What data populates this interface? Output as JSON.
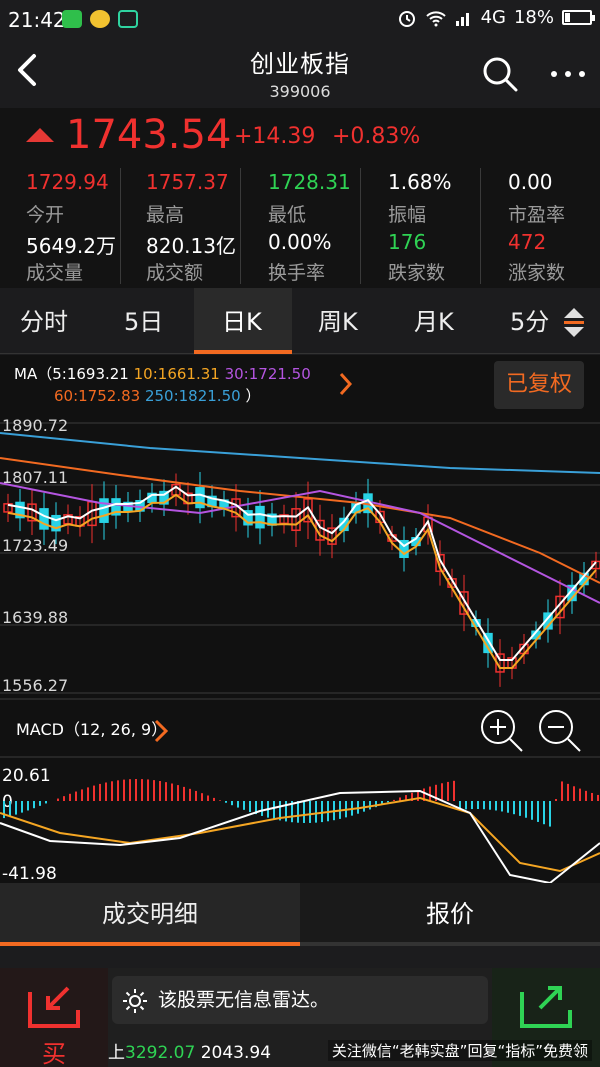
{
  "status_bar": {
    "time": "21:42",
    "network": "4G",
    "battery": "18%"
  },
  "header": {
    "title": "创业板指",
    "code": "399006"
  },
  "quote": {
    "price": "1743.54",
    "change": "+14.39",
    "change_pct": "+0.83%",
    "stats": [
      {
        "value": "1729.94",
        "label": "今开",
        "color": "red"
      },
      {
        "value": "1757.37",
        "label": "最高",
        "color": "red"
      },
      {
        "value": "1728.31",
        "label": "最低",
        "color": "green"
      },
      {
        "value": "1.68%",
        "label": "振幅",
        "color": "white"
      },
      {
        "value": "0.00",
        "label": "市盈率",
        "color": "white"
      },
      {
        "value": "5649.2万",
        "label": "成交量",
        "color": "white"
      },
      {
        "value": "820.13亿",
        "label": "成交额",
        "color": "white"
      },
      {
        "value": "0.00%",
        "label": "换手率",
        "color": "white"
      },
      {
        "value": "176",
        "label": "跌家数",
        "color": "green"
      },
      {
        "value": "472",
        "label": "涨家数",
        "color": "red"
      }
    ]
  },
  "period_tabs": [
    {
      "label": "分时",
      "active": false
    },
    {
      "label": "5日",
      "active": false
    },
    {
      "label": "日K",
      "active": true
    },
    {
      "label": "周K",
      "active": false
    },
    {
      "label": "月K",
      "active": false
    },
    {
      "label": "5分",
      "active": false
    }
  ],
  "ma_legend": {
    "prefix": "MA（",
    "ma5": "5:1693.21",
    "ma10": "10:1661.31",
    "ma30": "30:1721.50",
    "ma60": "60:1752.83",
    "ma250": "250:1821.50",
    "suffix": "）",
    "colors": {
      "ma5": "#ffffff",
      "ma10": "#f5a623",
      "ma30": "#b455e0",
      "ma60": "#f26a21",
      "ma250": "#3aa0d8"
    }
  },
  "adjust_button": "已复权",
  "kline_axis": [
    "1890.72",
    "1807.11",
    "1723.49",
    "1639.88",
    "1556.27"
  ],
  "macd": {
    "label": "MACD（12, 26, 9）",
    "top": "20.61",
    "zero": "0",
    "bottom": "-41.98"
  },
  "bottom_tabs": [
    {
      "label": "成交明细",
      "active": false
    },
    {
      "label": "报价",
      "active": true
    }
  ],
  "toolbar": {
    "buy_label": "买",
    "radar_text": "该股票无信息雷达。",
    "ticker_prefix": "上",
    "ticker_value1": "3292.07",
    "ticker_value2": "2043.94",
    "watermark": "关注微信“老韩实盘”回复“指标”免费领"
  },
  "colors": {
    "up": "#f0312f",
    "down": "#2fd354",
    "accent": "#f26a21",
    "candle_down": "#29d3e6"
  }
}
